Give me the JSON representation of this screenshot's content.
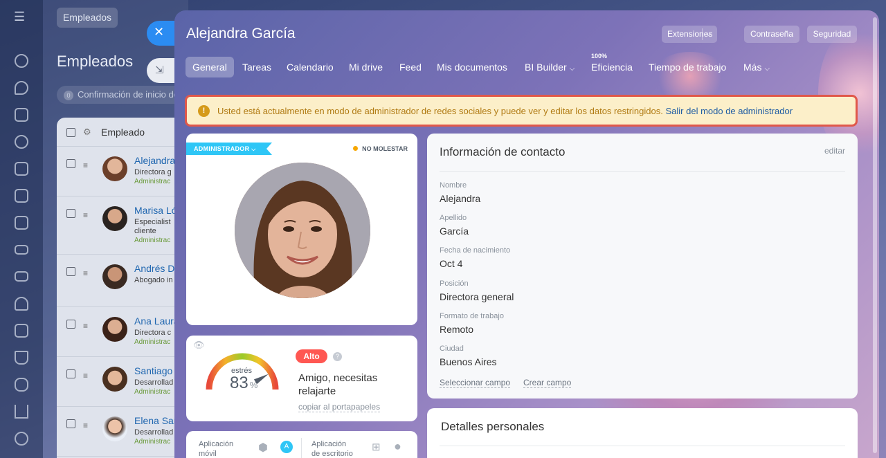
{
  "background": {
    "tag": "Empleados",
    "title": "Empleados",
    "confirm": {
      "count": "0",
      "text": "Confirmación de inicio de"
    },
    "table_header": "Empleado",
    "rows": [
      {
        "name": "Alejandra",
        "position": "Directora g",
        "role": "Administrac"
      },
      {
        "name": "Marisa Ló",
        "position": "Especialist",
        "position2": "cliente",
        "role": "Administrac"
      },
      {
        "name": "Andrés D",
        "position": "Abogado in",
        "role": ""
      },
      {
        "name": "Ana Laura",
        "position": "Directora c",
        "role": "Administrac"
      },
      {
        "name": "Santiago",
        "position": "Desarrollad",
        "role": "Administrac"
      },
      {
        "name": "Elena Sar",
        "position": "Desarrollad",
        "role": "Administrac"
      }
    ]
  },
  "panel": {
    "title": "Alejandra García",
    "header_buttons": {
      "extensions": "Extensiones",
      "password": "Contraseña",
      "security": "Seguridad"
    },
    "tabs": [
      "General",
      "Tareas",
      "Calendario",
      "Mi drive",
      "Feed",
      "Mis documentos",
      "BI Builder",
      "Eficiencia",
      "Tiempo de trabajo",
      "Más"
    ],
    "efficiency_sup": "100%",
    "alert": {
      "text": "Usted está actualmente en modo de administrador de redes sociales y puede ver y editar los datos restringidos.",
      "link": "Salir del modo de administrador"
    },
    "profile": {
      "role_tag": "ADMINISTRADOR",
      "status": "NO MOLESTAR"
    },
    "stress": {
      "label": "estrés",
      "value": "83",
      "unit": "%",
      "level": "Alto",
      "message": "Amigo, necesitas relajarte",
      "copy": "copiar al portapapeles",
      "gauge_fraction": 0.83
    },
    "apps": {
      "mobile_1": "Aplicación",
      "mobile_2": "móvil",
      "desktop_1": "Aplicación",
      "desktop_2": "de escritorio"
    },
    "contact": {
      "title": "Información de contacto",
      "edit": "editar",
      "fields": [
        {
          "label": "Nombre",
          "value": "Alejandra"
        },
        {
          "label": "Apellido",
          "value": "García"
        },
        {
          "label": "Fecha de nacimiento",
          "value": "Oct 4"
        },
        {
          "label": "Posición",
          "value": "Directora general"
        },
        {
          "label": "Formato de trabajo",
          "value": "Remoto"
        },
        {
          "label": "Ciudad",
          "value": "Buenos Aires"
        }
      ],
      "select_field": "Seleccionar campo",
      "create_field": "Crear campo"
    },
    "personal": {
      "title": "Detalles personales"
    }
  },
  "colors": {
    "accent": "#2fc6f6",
    "alert_bg": "#fcefc9",
    "alert_border": "#e0584a",
    "alto": "#ff5752",
    "link": "#2067b0"
  }
}
